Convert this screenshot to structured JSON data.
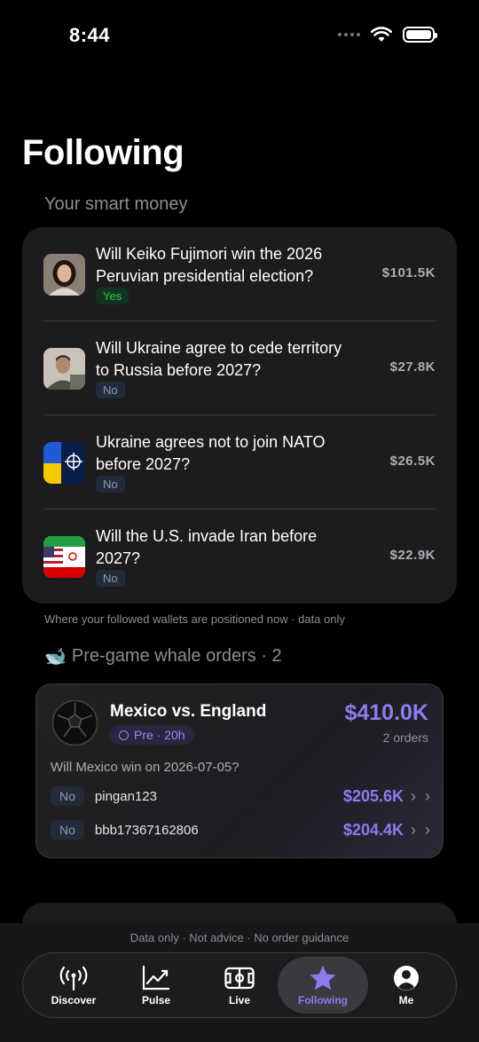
{
  "status_bar": {
    "time": "8:44"
  },
  "page": {
    "title": "Following"
  },
  "smart_money": {
    "title": "Your smart money",
    "items": [
      {
        "question": "Will Keiko Fujimori win the 2026 Peruvian presidential election?",
        "position": "Yes",
        "amount": "$101.5K",
        "thumb": "portrait-icon"
      },
      {
        "question": "Will Ukraine agree to cede territory to Russia before 2027?",
        "position": "No",
        "amount": "$27.8K",
        "thumb": "portrait-icon"
      },
      {
        "question": "Ukraine agrees not to join NATO before 2027?",
        "position": "No",
        "amount": "$26.5K",
        "thumb": "ukraine-nato-flag-icon"
      },
      {
        "question": "Will the U.S. invade Iran before 2027?",
        "position": "No",
        "amount": "$22.9K",
        "thumb": "us-iran-flag-icon"
      }
    ],
    "caption": "Where your followed wallets are positioned now · data only"
  },
  "whale_orders": {
    "icon": "🐋",
    "title": "Pre-game whale orders · 2",
    "card": {
      "match": "Mexico vs. England",
      "badge": "Pre · 20h",
      "total": "$410.0K",
      "orders_count": "2 orders",
      "question": "Will Mexico win on 2026-07-05?",
      "orders": [
        {
          "side": "No",
          "user": "pingan123",
          "amount": "$205.6K"
        },
        {
          "side": "No",
          "user": "bbb17367162806",
          "amount": "$204.4K"
        }
      ]
    }
  },
  "disclaimer": "Data only · Not advice · No order guidance",
  "tabs": [
    {
      "label": "Discover",
      "icon": "broadcast-icon"
    },
    {
      "label": "Pulse",
      "icon": "chart-line-icon"
    },
    {
      "label": "Live",
      "icon": "soccer-field-icon"
    },
    {
      "label": "Following",
      "icon": "star-icon",
      "active": true
    },
    {
      "label": "Me",
      "icon": "profile-icon"
    }
  ],
  "colors": {
    "accent": "#8b7cf0",
    "yes": "#34c759",
    "background": "#000000",
    "card": "#1c1c1e"
  }
}
